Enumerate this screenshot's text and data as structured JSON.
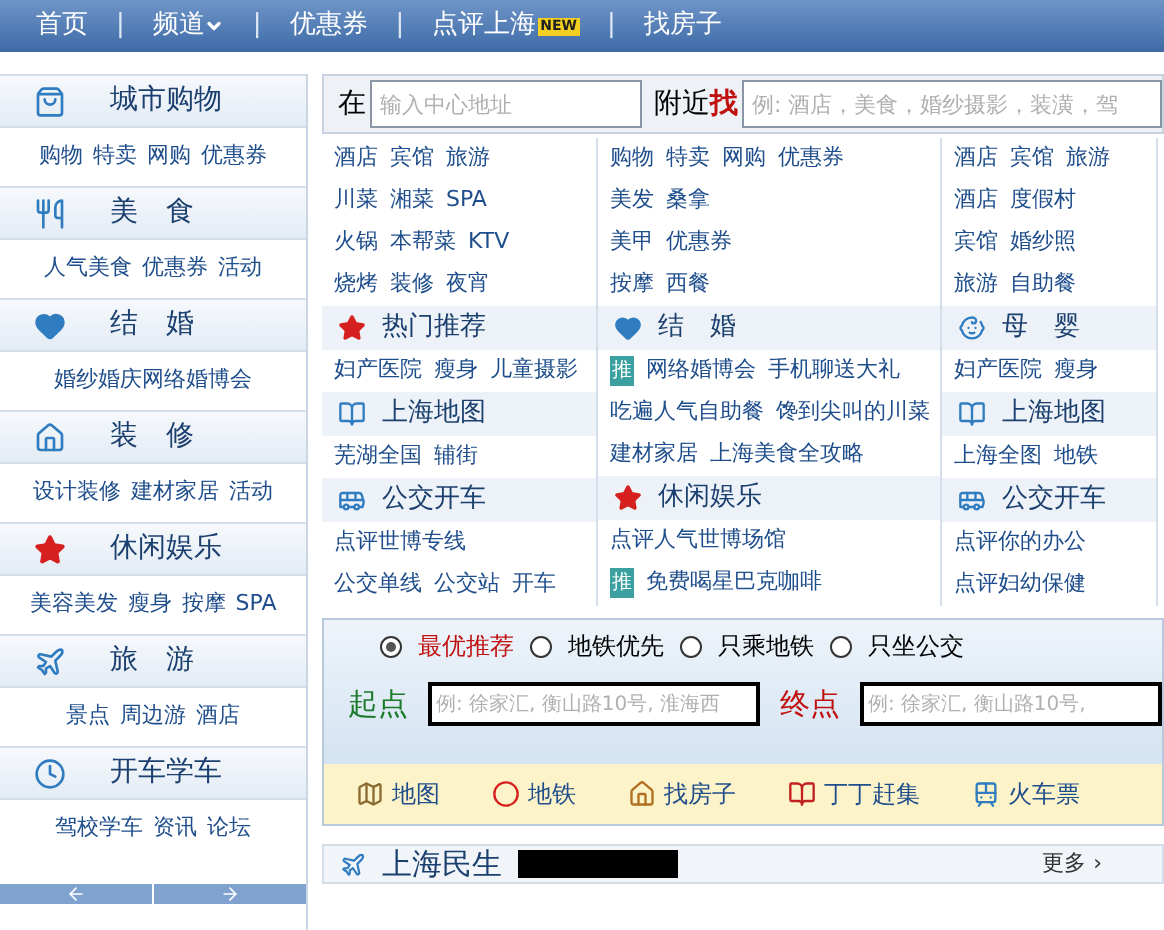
{
  "nav": {
    "separator": "|",
    "items": [
      {
        "label": "首页",
        "kind": "link"
      },
      {
        "label": "频道",
        "kind": "dropdown"
      },
      {
        "label": "优惠券",
        "kind": "link"
      },
      {
        "label": "点评上海",
        "kind": "link",
        "badge": "NEW"
      },
      {
        "label": "找房子",
        "kind": "link"
      }
    ]
  },
  "sidebar": {
    "categories": [
      {
        "title": "城市购物",
        "links": [
          "购物",
          "特卖",
          "网购",
          "优惠券"
        ]
      },
      {
        "title": "美　食",
        "links": [
          "人气美食",
          "优惠券",
          "活动"
        ]
      },
      {
        "title": "结　婚",
        "links": [
          "婚纱婚庆网络婚博会"
        ]
      },
      {
        "title": "装　修",
        "links": [
          "设计装修",
          "建材家居",
          "活动"
        ]
      },
      {
        "title": "休闲娱乐",
        "links": [
          "美容美发",
          "瘦身",
          "按摩",
          "SPA"
        ]
      },
      {
        "title": "旅　游",
        "links": [
          "景点",
          "周边游",
          "酒店"
        ]
      },
      {
        "title": "开车学车",
        "links": [
          "驾校学车",
          "资讯",
          "论坛"
        ]
      }
    ]
  },
  "search": {
    "prefix": "在",
    "address_placeholder": "输入中心地址",
    "near": "附近",
    "find": "找",
    "keyword_placeholder": "例: 酒店，美食，婚纱摄影，装潢，驾"
  },
  "grid": {
    "columns": [
      [
        {
          "kind": "links",
          "items": [
            "酒店",
            "宾馆",
            "旅游"
          ]
        },
        {
          "kind": "links",
          "items": [
            "川菜",
            "湘菜",
            "SPA"
          ]
        },
        {
          "kind": "links",
          "items": [
            "火锅",
            "本帮菜",
            "KTV"
          ]
        },
        {
          "kind": "links",
          "items": [
            "烧烤",
            "装修",
            "夜宵"
          ]
        },
        {
          "kind": "header",
          "title": "热门推荐"
        },
        {
          "kind": "links",
          "items": [
            "妇产医院",
            "瘦身",
            "儿童摄影"
          ]
        },
        {
          "kind": "header",
          "title": "上海地图"
        },
        {
          "kind": "links",
          "items": [
            "芜湖全国",
            "辅街"
          ]
        },
        {
          "kind": "header",
          "title": "公交开车"
        },
        {
          "kind": "links",
          "items": [
            "点评世博专线"
          ]
        },
        {
          "kind": "links",
          "items": [
            "公交单线",
            "公交站",
            "开车"
          ]
        }
      ],
      [
        {
          "kind": "links",
          "items": [
            "购物",
            "特卖",
            "网购",
            "优惠券"
          ]
        },
        {
          "kind": "links",
          "items": [
            "美发",
            "桑拿"
          ]
        },
        {
          "kind": "links",
          "items": [
            "美甲",
            "优惠券"
          ]
        },
        {
          "kind": "links",
          "items": [
            "按摩",
            "西餐"
          ]
        },
        {
          "kind": "header",
          "title": "结　婚"
        },
        {
          "kind": "links",
          "items": [
            "网络婚博会",
            "手机聊送大礼"
          ],
          "badge": "推"
        },
        {
          "kind": "links",
          "items": [
            "吃遍人气自助餐",
            "馋到尖叫的川菜"
          ]
        },
        {
          "kind": "links",
          "items": [
            "建材家居",
            "上海美食全攻略"
          ]
        },
        {
          "kind": "header",
          "title": "休闲娱乐"
        },
        {
          "kind": "links",
          "items": [
            "点评人气世博场馆"
          ]
        },
        {
          "kind": "links",
          "items": [
            "免费喝星巴克咖啡"
          ],
          "badge": "推"
        }
      ],
      [
        {
          "kind": "links",
          "items": [
            "酒店",
            "宾馆",
            "旅游"
          ]
        },
        {
          "kind": "links",
          "items": [
            "酒店",
            "度假村"
          ]
        },
        {
          "kind": "links",
          "items": [
            "宾馆",
            "婚纱照"
          ]
        },
        {
          "kind": "links",
          "items": [
            "旅游",
            "自助餐"
          ]
        },
        {
          "kind": "header",
          "title": "母　婴"
        },
        {
          "kind": "links",
          "items": [
            "妇产医院",
            "瘦身"
          ]
        },
        {
          "kind": "header",
          "title": "上海地图"
        },
        {
          "kind": "links",
          "items": [
            "上海全图",
            "地铁"
          ]
        },
        {
          "kind": "header",
          "title": "公交开车"
        },
        {
          "kind": "links",
          "items": [
            "点评你的办公"
          ]
        },
        {
          "kind": "links",
          "items": [
            "点评妇幼保健"
          ]
        }
      ]
    ]
  },
  "route": {
    "options": [
      {
        "label": "最优推荐",
        "selected": true
      },
      {
        "label": "地铁优先",
        "selected": false
      },
      {
        "label": "只乘地铁",
        "selected": false
      },
      {
        "label": "只坐公交",
        "selected": false
      }
    ],
    "start_label": "起点",
    "start_placeholder": "例: 徐家汇, 衡山路10号, 淮海西",
    "end_label": "终点",
    "end_placeholder": "例: 徐家汇, 衡山路10号,",
    "links": [
      "地图",
      "地铁",
      "找房子",
      "丁丁赶集",
      "火车票"
    ]
  },
  "news": {
    "title": "上海民生",
    "more": "更多 ›"
  }
}
